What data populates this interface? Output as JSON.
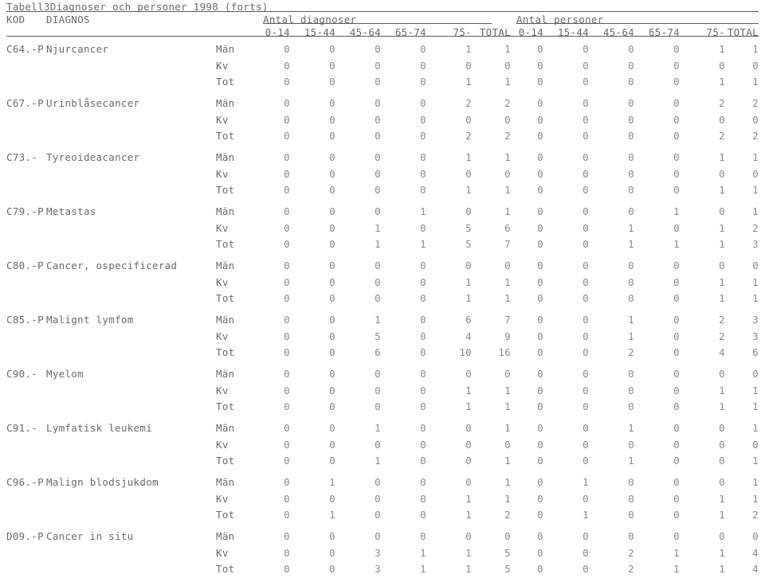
{
  "document": {
    "title": "Tabell3Diagnoser och personer 1998 (forts)"
  },
  "header": {
    "kod": "KOD",
    "diagnos": "DIAGNOS",
    "group_diagnoser": "Antal diagnoser",
    "group_personer": "Antal personer",
    "age_columns": [
      "0-14",
      "15-44",
      "45-64",
      "65-74",
      "75-",
      "TOTAL"
    ]
  },
  "table": {
    "sex_labels": [
      "Män",
      "Kv",
      "Tot"
    ],
    "rows": [
      {
        "code": "C64.-P",
        "diagnos": "Njurcancer",
        "diagnoser": [
          [
            0,
            0,
            0,
            0,
            1,
            1
          ],
          [
            0,
            0,
            0,
            0,
            0,
            0
          ],
          [
            0,
            0,
            0,
            0,
            1,
            1
          ]
        ],
        "personer": [
          [
            0,
            0,
            0,
            0,
            1,
            1
          ],
          [
            0,
            0,
            0,
            0,
            0,
            0
          ],
          [
            0,
            0,
            0,
            0,
            1,
            1
          ]
        ]
      },
      {
        "code": "C67.-P",
        "diagnos": "Urinblåsecancer",
        "diagnoser": [
          [
            0,
            0,
            0,
            0,
            2,
            2
          ],
          [
            0,
            0,
            0,
            0,
            0,
            0
          ],
          [
            0,
            0,
            0,
            0,
            2,
            2
          ]
        ],
        "personer": [
          [
            0,
            0,
            0,
            0,
            2,
            2
          ],
          [
            0,
            0,
            0,
            0,
            0,
            0
          ],
          [
            0,
            0,
            0,
            0,
            2,
            2
          ]
        ]
      },
      {
        "code": "C73.-",
        "diagnos": "Tyreoideacancer",
        "diagnoser": [
          [
            0,
            0,
            0,
            0,
            1,
            1
          ],
          [
            0,
            0,
            0,
            0,
            0,
            0
          ],
          [
            0,
            0,
            0,
            0,
            1,
            1
          ]
        ],
        "personer": [
          [
            0,
            0,
            0,
            0,
            1,
            1
          ],
          [
            0,
            0,
            0,
            0,
            0,
            0
          ],
          [
            0,
            0,
            0,
            0,
            1,
            1
          ]
        ]
      },
      {
        "code": "C79.-P",
        "diagnos": "Metastas",
        "diagnoser": [
          [
            0,
            0,
            0,
            1,
            0,
            1
          ],
          [
            0,
            0,
            1,
            0,
            5,
            6
          ],
          [
            0,
            0,
            1,
            1,
            5,
            7
          ]
        ],
        "personer": [
          [
            0,
            0,
            0,
            1,
            0,
            1
          ],
          [
            0,
            0,
            1,
            0,
            1,
            2
          ],
          [
            0,
            0,
            1,
            1,
            1,
            3
          ]
        ]
      },
      {
        "code": "C80.-P",
        "diagnos": "Cancer, ospecificerad",
        "diagnoser": [
          [
            0,
            0,
            0,
            0,
            0,
            0
          ],
          [
            0,
            0,
            0,
            0,
            1,
            1
          ],
          [
            0,
            0,
            0,
            0,
            1,
            1
          ]
        ],
        "personer": [
          [
            0,
            0,
            0,
            0,
            0,
            0
          ],
          [
            0,
            0,
            0,
            0,
            1,
            1
          ],
          [
            0,
            0,
            0,
            0,
            1,
            1
          ]
        ]
      },
      {
        "code": "C85.-P",
        "diagnos": "Malignt lymfom",
        "diagnoser": [
          [
            0,
            0,
            1,
            0,
            6,
            7
          ],
          [
            0,
            0,
            5,
            0,
            4,
            9
          ],
          [
            0,
            0,
            6,
            0,
            10,
            16
          ]
        ],
        "personer": [
          [
            0,
            0,
            1,
            0,
            2,
            3
          ],
          [
            0,
            0,
            1,
            0,
            2,
            3
          ],
          [
            0,
            0,
            2,
            0,
            4,
            6
          ]
        ]
      },
      {
        "code": "C90.-",
        "diagnos": "Myelom",
        "diagnoser": [
          [
            0,
            0,
            0,
            0,
            0,
            0
          ],
          [
            0,
            0,
            0,
            0,
            1,
            1
          ],
          [
            0,
            0,
            0,
            0,
            1,
            1
          ]
        ],
        "personer": [
          [
            0,
            0,
            0,
            0,
            0,
            0
          ],
          [
            0,
            0,
            0,
            0,
            1,
            1
          ],
          [
            0,
            0,
            0,
            0,
            1,
            1
          ]
        ]
      },
      {
        "code": "C91.-",
        "diagnos": "Lymfatisk leukemi",
        "diagnoser": [
          [
            0,
            0,
            1,
            0,
            0,
            1
          ],
          [
            0,
            0,
            0,
            0,
            0,
            0
          ],
          [
            0,
            0,
            1,
            0,
            0,
            1
          ]
        ],
        "personer": [
          [
            0,
            0,
            1,
            0,
            0,
            1
          ],
          [
            0,
            0,
            0,
            0,
            0,
            0
          ],
          [
            0,
            0,
            1,
            0,
            0,
            1
          ]
        ]
      },
      {
        "code": "C96.-P",
        "diagnos": "Malign blodsjukdom",
        "diagnoser": [
          [
            0,
            1,
            0,
            0,
            0,
            1
          ],
          [
            0,
            0,
            0,
            0,
            1,
            1
          ],
          [
            0,
            1,
            0,
            0,
            1,
            2
          ]
        ],
        "personer": [
          [
            0,
            1,
            0,
            0,
            0,
            1
          ],
          [
            0,
            0,
            0,
            0,
            1,
            1
          ],
          [
            0,
            1,
            0,
            0,
            1,
            2
          ]
        ]
      },
      {
        "code": "D09.-P",
        "diagnos": "Cancer in situ",
        "diagnoser": [
          [
            0,
            0,
            0,
            0,
            0,
            0
          ],
          [
            0,
            0,
            3,
            1,
            1,
            5
          ],
          [
            0,
            0,
            3,
            1,
            1,
            5
          ]
        ],
        "personer": [
          [
            0,
            0,
            0,
            0,
            0,
            0
          ],
          [
            0,
            0,
            2,
            1,
            1,
            4
          ],
          [
            0,
            0,
            2,
            1,
            1,
            4
          ]
        ]
      }
    ]
  }
}
